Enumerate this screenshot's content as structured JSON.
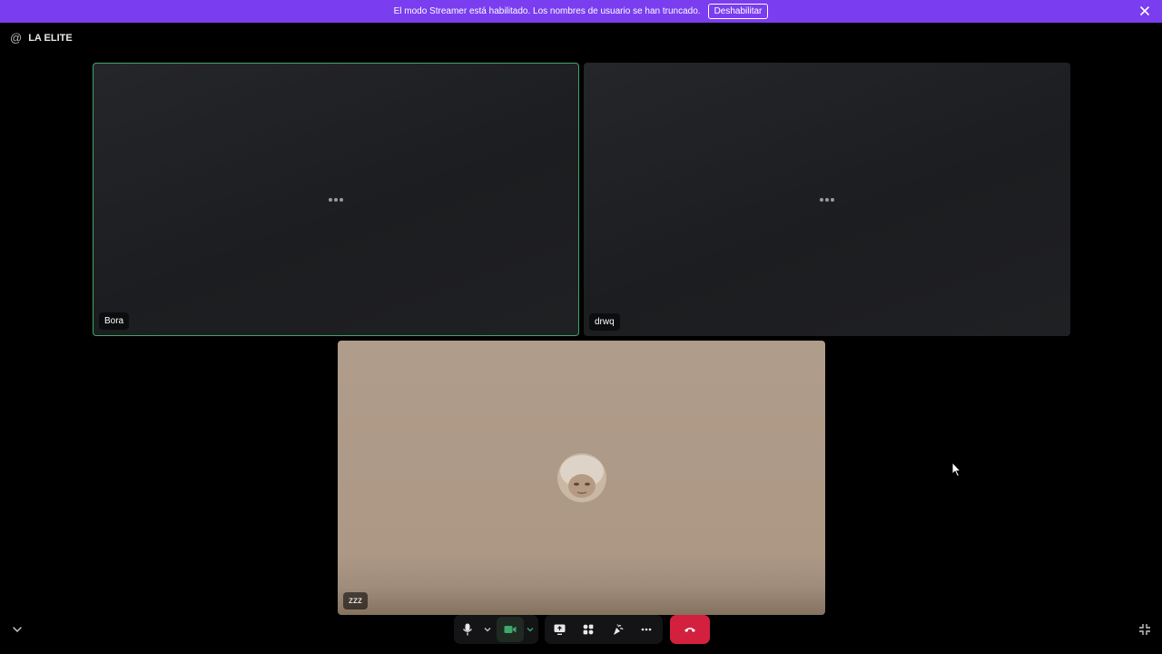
{
  "notice": {
    "text": "El modo Streamer está habilitado. Los nombres de usuario se han truncado.",
    "button_label": "Deshabilitar",
    "background_color": "#7a3df0"
  },
  "header": {
    "icon": "at-icon",
    "title": "LA ELITE"
  },
  "participants": [
    {
      "name": "Bora",
      "state": "camera-off",
      "speaking": true
    },
    {
      "name": "drwq",
      "state": "camera-off",
      "speaking": false
    },
    {
      "name": "zzz",
      "state": "avatar",
      "speaking": false
    }
  ],
  "controls": {
    "icons": [
      "mic-icon",
      "chevron-down-icon",
      "camera-icon",
      "chevron-down-icon",
      "screen-share-icon",
      "activities-icon",
      "soundboard-icon",
      "more-icon",
      "hangup-icon"
    ],
    "hangup_color": "#d3203f",
    "active_camera_color": "#3fa76a"
  },
  "colors": {
    "speaking_border": "#3fa76a",
    "tile_background": "#1f2023"
  }
}
